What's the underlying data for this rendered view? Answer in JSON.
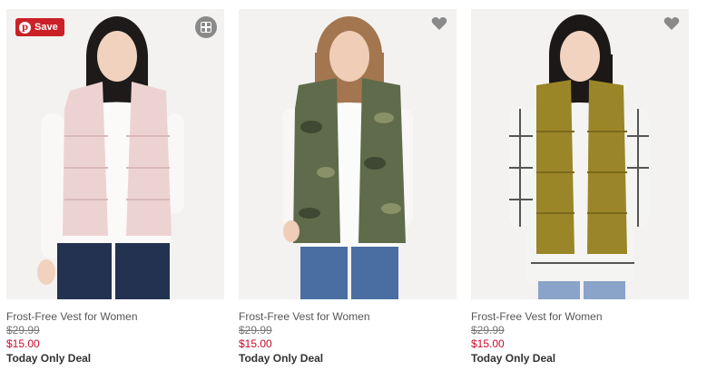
{
  "products": [
    {
      "name": "Frost-Free Vest for Women",
      "was_price": "$29.99",
      "sale_price": "$15.00",
      "promo": "Today Only Deal",
      "vest_color": "#ecd3d1",
      "vest_shade": "#d9b9b7",
      "pinterest_save_label": "Save"
    },
    {
      "name": "Frost-Free Vest for Women",
      "was_price": "$29.99",
      "sale_price": "$15.00",
      "promo": "Today Only Deal",
      "vest_color": "#5f6b4a",
      "vest_shade": "#3f4832"
    },
    {
      "name": "Frost-Free Vest for Women",
      "was_price": "$29.99",
      "sale_price": "$15.00",
      "promo": "Today Only Deal",
      "vest_color": "#9a8628",
      "vest_shade": "#7a6a1d"
    }
  ],
  "icons": {
    "pinterest": "pinterest-icon",
    "quick_look": "quick-look-icon",
    "favorite": "heart-icon"
  },
  "colors": {
    "sale_price": "#cc0a2f",
    "pinterest_red": "#cb2027"
  }
}
